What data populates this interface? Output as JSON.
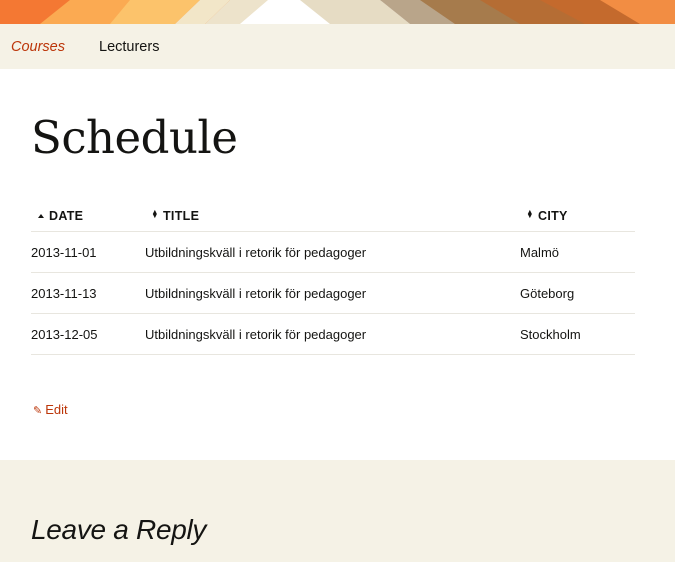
{
  "colors": {
    "accent": "#bc360a",
    "nav_background": "#f5f2e6",
    "reply_background": "#f5f2e6",
    "text": "#141412",
    "banner": [
      "#f47e3a",
      "#fda64a",
      "#e8d9b8",
      "#a5774a",
      "#c56a2a"
    ]
  },
  "nav": {
    "items": [
      {
        "label": "Courses",
        "active": true
      },
      {
        "label": "Lecturers",
        "active": false
      }
    ]
  },
  "page": {
    "title": "Schedule"
  },
  "schedule": {
    "columns": [
      {
        "label": "DATE",
        "sort": "ascending",
        "icon": "sort-up-icon"
      },
      {
        "label": "TITLE",
        "sort": "none",
        "icon": "sort-both-icon"
      },
      {
        "label": "CITY",
        "sort": "none",
        "icon": "sort-both-icon"
      }
    ],
    "rows": [
      {
        "date": "2013-11-01",
        "title": "Utbildningskväll i retorik för pedagoger",
        "city": "Malmö"
      },
      {
        "date": "2013-11-13",
        "title": "Utbildningskväll i retorik för pedagoger",
        "city": "Göteborg"
      },
      {
        "date": "2013-12-05",
        "title": "Utbildningskväll i retorik för pedagoger",
        "city": "Stockholm"
      }
    ]
  },
  "edit": {
    "label": "Edit",
    "icon": "pencil-icon"
  },
  "reply": {
    "title": "Leave a Reply"
  }
}
